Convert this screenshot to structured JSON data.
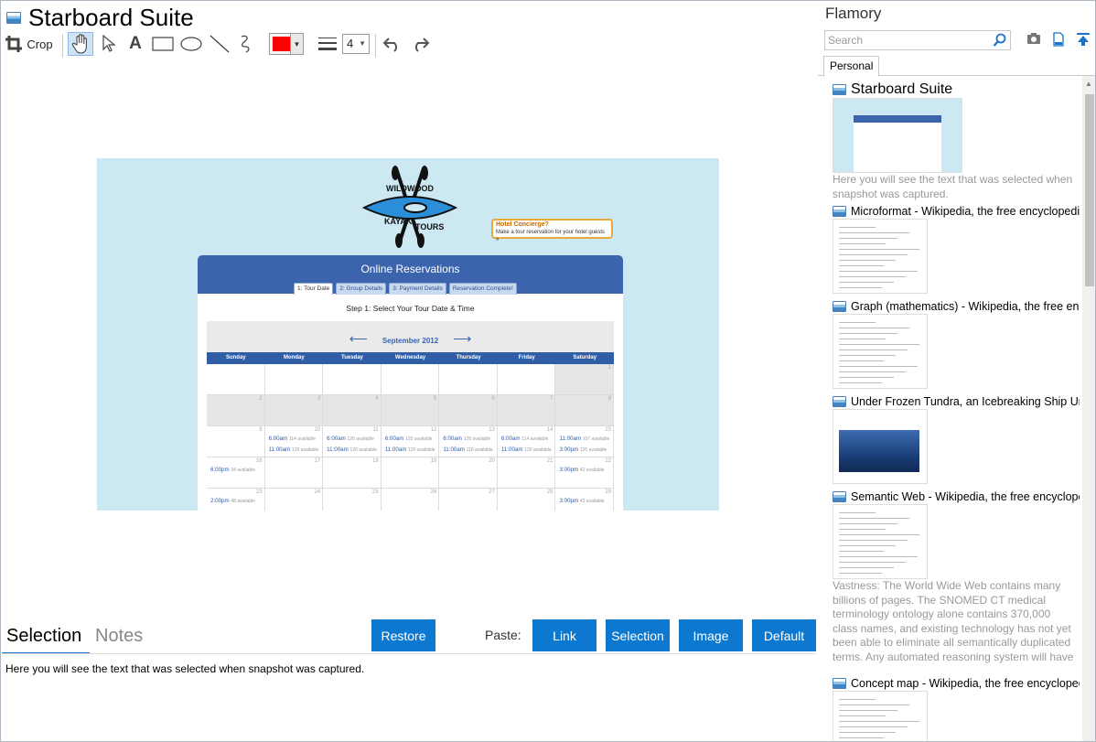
{
  "window": {
    "title": "Starboard Suite"
  },
  "toolbar": {
    "crop_label": "Crop",
    "line_width_value": "4"
  },
  "colors": {
    "accent": "#0d78d0",
    "pen": "#ff0000",
    "header_blue": "#3b64ad"
  },
  "screenshot": {
    "logo": {
      "line1": "WILDWOOD",
      "line2": "KAYAK",
      "line3": "TOURS"
    },
    "concierge": {
      "title": "Hotel Concierge?",
      "text": "Make a tour reservation for your hotel guests »"
    },
    "heading": "Online Reservations",
    "tabs": [
      "1: Tour Date",
      "2: Group Details",
      "3: Payment Details",
      "Reservation Complete!"
    ],
    "step": "Step 1: Select Your Tour Date & Time",
    "month": "September 2012",
    "days": [
      "Sunday",
      "Monday",
      "Tuesday",
      "Wednesday",
      "Thursday",
      "Friday",
      "Saturday"
    ],
    "weeks": [
      [
        {
          "n": "",
          "g": false
        },
        {
          "n": "",
          "g": false
        },
        {
          "n": "",
          "g": false
        },
        {
          "n": "",
          "g": false
        },
        {
          "n": "",
          "g": false
        },
        {
          "n": "",
          "g": false
        },
        {
          "n": "1",
          "g": true
        }
      ],
      [
        {
          "n": "2",
          "g": true
        },
        {
          "n": "3",
          "g": true
        },
        {
          "n": "4",
          "g": true
        },
        {
          "n": "5",
          "g": true
        },
        {
          "n": "6",
          "g": true
        },
        {
          "n": "7",
          "g": true
        },
        {
          "n": "8",
          "g": true
        }
      ],
      [
        {
          "n": "9",
          "g": false
        },
        {
          "n": "10",
          "s": [
            [
              "6:00am",
              "114 available"
            ],
            [
              "11:00am",
              "120 available"
            ]
          ]
        },
        {
          "n": "11",
          "s": [
            [
              "6:00am",
              "120 available"
            ],
            [
              "11:00am",
              "120 available"
            ]
          ]
        },
        {
          "n": "12",
          "s": [
            [
              "6:00am",
              "120 available"
            ],
            [
              "11:00am",
              "120 available"
            ]
          ]
        },
        {
          "n": "13",
          "s": [
            [
              "6:00am",
              "120 available"
            ],
            [
              "11:00am",
              "118 available"
            ]
          ]
        },
        {
          "n": "14",
          "s": [
            [
              "6:00am",
              "114 available"
            ],
            [
              "11:00am",
              "120 available"
            ]
          ]
        },
        {
          "n": "15",
          "s": [
            [
              "11:00am",
              "107 available"
            ],
            [
              "3:00pm",
              "120 available"
            ]
          ]
        }
      ],
      [
        {
          "n": "16",
          "s": [
            [
              "6:00pm",
              "34 available"
            ]
          ]
        },
        {
          "n": "17"
        },
        {
          "n": "18"
        },
        {
          "n": "19"
        },
        {
          "n": "20"
        },
        {
          "n": "21"
        },
        {
          "n": "22",
          "s": [
            [
              "3:00pm",
              "42 available"
            ]
          ]
        }
      ],
      [
        {
          "n": "23",
          "s": [
            [
              "2:00pm",
              "48 available"
            ]
          ]
        },
        {
          "n": "24"
        },
        {
          "n": "25"
        },
        {
          "n": "26"
        },
        {
          "n": "27"
        },
        {
          "n": "28"
        },
        {
          "n": "29",
          "s": [
            [
              "3:00pm",
              "43 available"
            ]
          ]
        }
      ]
    ]
  },
  "bottom": {
    "tab_selection": "Selection",
    "tab_notes": "Notes",
    "restore": "Restore",
    "paste_label": "Paste:",
    "paste_buttons": [
      "Link",
      "Selection",
      "Image",
      "Default"
    ],
    "selection_text": "Here you will see the text that was selected when snapshot was captured."
  },
  "sidebar": {
    "brand": "Flamory",
    "search_placeholder": "Search",
    "tab": "Personal",
    "items": [
      {
        "title": "Starboard Suite",
        "desc": "Here you will see the text that was selected when snapshot was captured."
      },
      {
        "title": "Microformat - Wikipedia, the free encyclopedia",
        "desc": ""
      },
      {
        "title": "Graph (mathematics) - Wikipedia, the free encyclopedia",
        "desc": ""
      },
      {
        "title": "Under Frozen Tundra, an Icebreaking Ship Uncovers...",
        "desc": ""
      },
      {
        "title": "Semantic Web - Wikipedia, the free encyclopedia",
        "desc": "Vastness: The World Wide Web contains many billions of pages. The SNOMED CT medical terminology ontology alone contains 370,000 class names, and existing technology has not yet been able to eliminate all semantically duplicated terms. Any automated reasoning system will have to deal with truly huge inputs."
      },
      {
        "title": "Concept map - Wikipedia, the free encyclopedia",
        "desc": ""
      }
    ]
  }
}
